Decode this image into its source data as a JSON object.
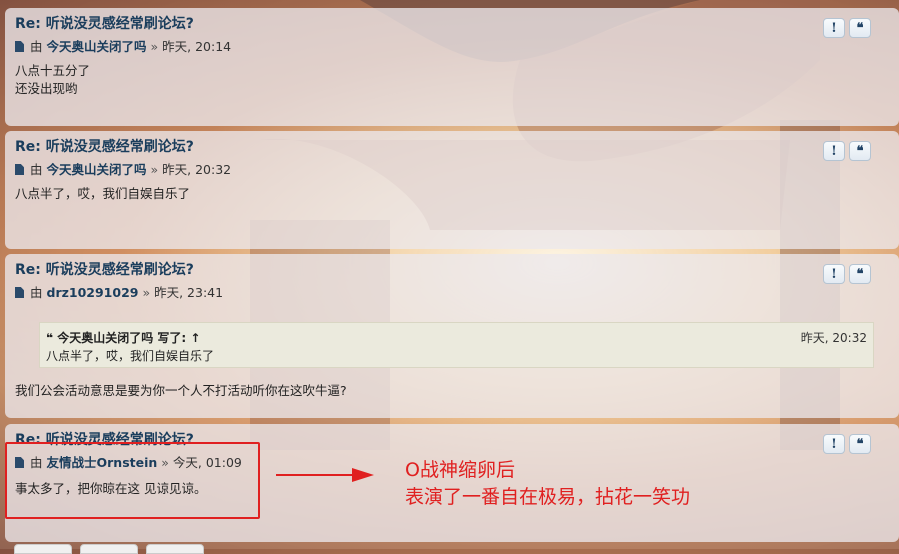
{
  "posts": [
    {
      "title": "Re: 听说没灵感经常刷论坛?",
      "by": "由",
      "author": "今天奥山关闭了吗",
      "sep": "»",
      "time": "昨天, 20:14",
      "body": [
        "八点十五分了",
        "还没出现哟"
      ]
    },
    {
      "title": "Re: 听说没灵感经常刷论坛?",
      "by": "由",
      "author": "今天奥山关闭了吗",
      "sep": "»",
      "time": "昨天, 20:32",
      "body": [
        "八点半了，哎，我们自娱自乐了"
      ]
    },
    {
      "title": "Re: 听说没灵感经常刷论坛?",
      "by": "由",
      "author": "drz10291029",
      "sep": "»",
      "time": "昨天, 23:41",
      "quote": {
        "icon": "❝",
        "author_line": "今天奥山关闭了吗 写了: ↑",
        "time": "昨天, 20:32",
        "text": "八点半了，哎，我们自娱自乐了"
      },
      "body": [
        "我们公会活动意思是要为你一个人不打活动听你在这吹牛逼?"
      ]
    },
    {
      "title": "Re: 听说没灵感经常刷论坛?",
      "by": "由",
      "author": "友情战士Ornstein",
      "sep": "»",
      "time": "今天, 01:09",
      "body": [
        "事太多了，把你晾在这 见谅见谅。"
      ]
    }
  ],
  "buttons": {
    "report": "!",
    "quote": "❝"
  },
  "annotation": {
    "line1": "O战神缩卵后",
    "line2": "表演了一番自在极易，拈花一笑功",
    "color": "#e02020"
  }
}
